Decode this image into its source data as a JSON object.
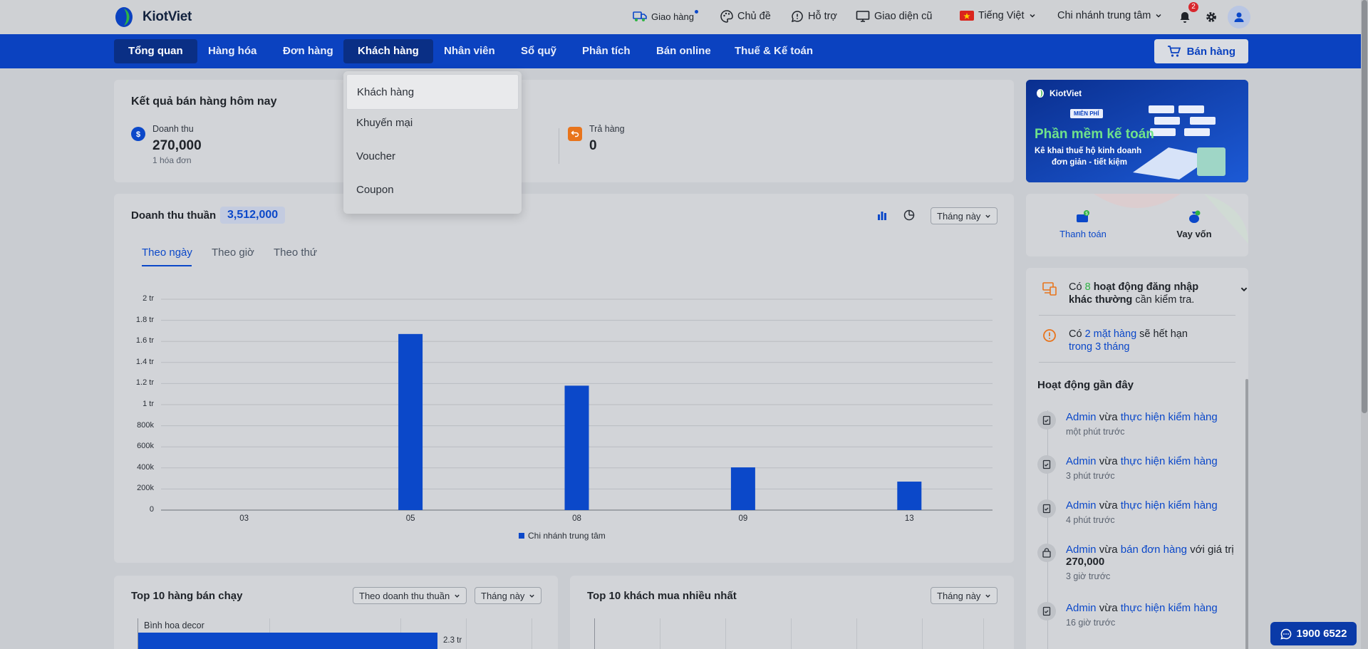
{
  "brand": {
    "name": "KiotViet"
  },
  "topbar": {
    "delivery": "Giao hàng",
    "theme": "Chủ đề",
    "support": "Hỗ trợ",
    "old_ui": "Giao diện cũ",
    "language": "Tiếng Việt",
    "branch": "Chi nhánh trung tâm",
    "notification_count": "2"
  },
  "nav": {
    "items": [
      "Tổng quan",
      "Hàng hóa",
      "Đơn hàng",
      "Khách hàng",
      "Nhân viên",
      "Sổ quỹ",
      "Phân tích",
      "Bán online",
      "Thuế & Kế toán"
    ],
    "sell_label": "Bán hàng"
  },
  "dropdown": {
    "items": [
      "Khách hàng",
      "Khuyến mại",
      "Voucher",
      "Coupon"
    ]
  },
  "today": {
    "title": "Kết quả bán hàng hôm nay",
    "revenue_label": "Doanh thu",
    "revenue_value": "270,000",
    "revenue_sub": "1 hóa đơn",
    "return_label": "Trả hàng",
    "return_value": "0"
  },
  "net": {
    "title": "Doanh thu thuần",
    "value": "3,512,000",
    "period": "Tháng này",
    "tabs": [
      "Theo ngày",
      "Theo giờ",
      "Theo thứ"
    ]
  },
  "chart_data": {
    "type": "bar",
    "categories": [
      "03",
      "05",
      "08",
      "09",
      "13"
    ],
    "series": [
      {
        "name": "Chi nhánh trung tâm",
        "values": [
          0,
          1670000,
          1180000,
          405000,
          270000
        ]
      }
    ],
    "ylim": [
      0,
      2000000
    ],
    "yticks": [
      "0",
      "200k",
      "400k",
      "600k",
      "800k",
      "1 tr",
      "1.2 tr",
      "1.4 tr",
      "1.6 tr",
      "1.8 tr",
      "2 tr"
    ],
    "legend": "bottom",
    "grid": true,
    "bar_color": "#0b48c9"
  },
  "top_products": {
    "title": "Top 10 hàng bán chạy",
    "sort": "Theo doanh thu thuần",
    "period": "Tháng này",
    "first_item": "Bình hoa decor",
    "first_value": "2.3 tr",
    "first_value_num": 2300000
  },
  "top_customers": {
    "title": "Top 10 khách mua nhiều nhất",
    "period": "Tháng này"
  },
  "promo": {
    "brand": "KiotViet",
    "badge": "MIỄN PHÍ",
    "headline": "Phần mềm kế toán",
    "sub1": "Kê khai thuế hộ kinh doanh",
    "sub2": "đơn giản - tiết kiệm"
  },
  "quick": {
    "pay": "Thanh toán",
    "loan": "Vay vốn"
  },
  "alerts": {
    "login_pre": "Có",
    "login_count": "8",
    "login_bold": "hoạt động đăng nhập khác thường",
    "login_post": "cần kiểm tra.",
    "expire_pre": "Có",
    "expire_link": "2 mặt hàng",
    "expire_mid": "sẽ hết hạn",
    "expire_link2": "trong 3 tháng"
  },
  "activity": {
    "title": "Hoạt động gần đây",
    "items": [
      {
        "user": "Admin",
        "verb": "vừa",
        "action": "thực hiện kiểm hàng",
        "extra": "",
        "amount": "",
        "time": "một phút trước"
      },
      {
        "user": "Admin",
        "verb": "vừa",
        "action": "thực hiện kiểm hàng",
        "extra": "",
        "amount": "",
        "time": "3 phút trước"
      },
      {
        "user": "Admin",
        "verb": "vừa",
        "action": "thực hiện kiểm hàng",
        "extra": "",
        "amount": "",
        "time": "4 phút trước"
      },
      {
        "user": "Admin",
        "verb": "vừa",
        "action": "bán đơn hàng",
        "extra": "với giá trị",
        "amount": "270,000",
        "time": "3 giờ trước"
      },
      {
        "user": "Admin",
        "verb": "vừa",
        "action": "thực hiện kiểm hàng",
        "extra": "",
        "amount": "",
        "time": "16 giờ trước"
      }
    ]
  },
  "hotline": "1900 6522"
}
